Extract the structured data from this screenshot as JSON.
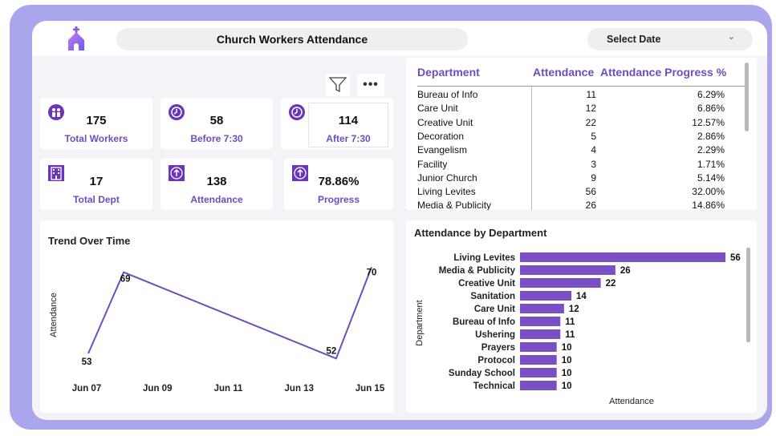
{
  "header": {
    "title": "Church Workers Attendance",
    "date_select_label": "Select Date"
  },
  "kpis": [
    {
      "value": "175",
      "label": "Total Workers"
    },
    {
      "value": "58",
      "label": "Before 7:30"
    },
    {
      "value": "114",
      "label": "After 7:30"
    },
    {
      "value": "17",
      "label": "Total Dept"
    },
    {
      "value": "138",
      "label": "Attendance"
    },
    {
      "value": "78.86%",
      "label": "Progress"
    }
  ],
  "table": {
    "headers": [
      "Department",
      "Attendance",
      "Attendance Progress %"
    ],
    "rows": [
      [
        "Bureau of Info",
        "11",
        "6.29%"
      ],
      [
        "Care Unit",
        "12",
        "6.86%"
      ],
      [
        "Creative Unit",
        "22",
        "12.57%"
      ],
      [
        "Decoration",
        "5",
        "2.86%"
      ],
      [
        "Evangelism",
        "4",
        "2.29%"
      ],
      [
        "Facility",
        "3",
        "1.71%"
      ],
      [
        "Junior Church",
        "9",
        "5.14%"
      ],
      [
        "Living Levites",
        "56",
        "32.00%"
      ],
      [
        "Media & Publicity",
        "26",
        "14.86%"
      ]
    ]
  },
  "colors": {
    "accent": "#6b4ec0",
    "bar": "#7a4fc6",
    "frame": "#a9a6ec",
    "background": "#f3f3f8"
  },
  "chart_data": [
    {
      "type": "line",
      "title": "Trend Over Time",
      "xlabel": "",
      "ylabel": "Attendance",
      "x_ticks": [
        "Jun 07",
        "Jun 09",
        "Jun 11",
        "Jun 13",
        "Jun 15"
      ],
      "x": [
        "2024-06-07",
        "2024-06-08",
        "2024-06-14",
        "2024-06-15"
      ],
      "values": [
        53,
        69,
        52,
        70
      ],
      "ylim": [
        50,
        71
      ],
      "grid": false
    },
    {
      "type": "bar",
      "orientation": "horizontal",
      "title": "Attendance by Department",
      "xlabel": "Attendance",
      "ylabel": "Department",
      "categories": [
        "Living Levites",
        "Media & Publicity",
        "Creative Unit",
        "Sanitation",
        "Care Unit",
        "Bureau of Info",
        "Ushering",
        "Prayers",
        "Protocol",
        "Sunday School",
        "Technical"
      ],
      "values": [
        56,
        26,
        22,
        14,
        12,
        11,
        11,
        10,
        10,
        10,
        10
      ],
      "xlim": [
        0,
        56
      ],
      "grid": false
    }
  ]
}
